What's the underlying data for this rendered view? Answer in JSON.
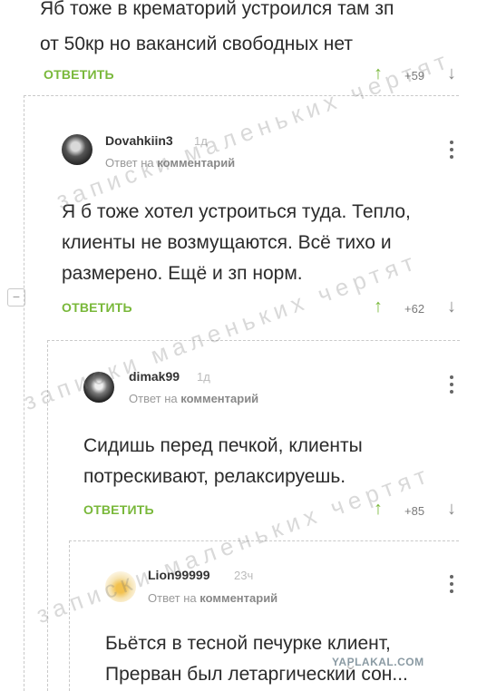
{
  "comments": [
    {
      "text_lines": [
        "Яб тоже в крематорий устроился там зп",
        "от 50кр но вакансий свободных нет"
      ],
      "reply_label": "ОТВЕТИТЬ",
      "score": "+59"
    },
    {
      "username": "Dovahkiin3",
      "time": "1д",
      "reply_to_prefix": "Ответ на",
      "reply_to_link": "комментарий",
      "text_lines": [
        "Я б тоже хотел устроиться туда. Тепло,",
        "клиенты не возмущаются. Всё тихо и",
        "размерено. Ещё и зп норм."
      ],
      "reply_label": "ОТВЕТИТЬ",
      "score": "+62"
    },
    {
      "username": "dimak99",
      "time": "1д",
      "reply_to_prefix": "Ответ на",
      "reply_to_link": "комментарий",
      "text_lines": [
        "Сидишь перед печкой, клиенты",
        "потрескивают, релаксируешь."
      ],
      "reply_label": "ОТВЕТИТЬ",
      "score": "+85"
    },
    {
      "username": "Lion99999",
      "time": "23ч",
      "reply_to_prefix": "Ответ на",
      "reply_to_link": "комментарий",
      "text_lines": [
        "Бьётся в тесной печурке клиент,",
        "Прерван был летаргический сон..."
      ]
    }
  ],
  "icons": {
    "upvote": "↑",
    "downvote": "↓",
    "collapse": "−"
  },
  "watermark": "записки маленьких чертят",
  "site_mark": "YAPLAKAL.COM",
  "colors": {
    "accent": "#79b83a",
    "text": "#2b2b2b",
    "muted": "#999999"
  }
}
